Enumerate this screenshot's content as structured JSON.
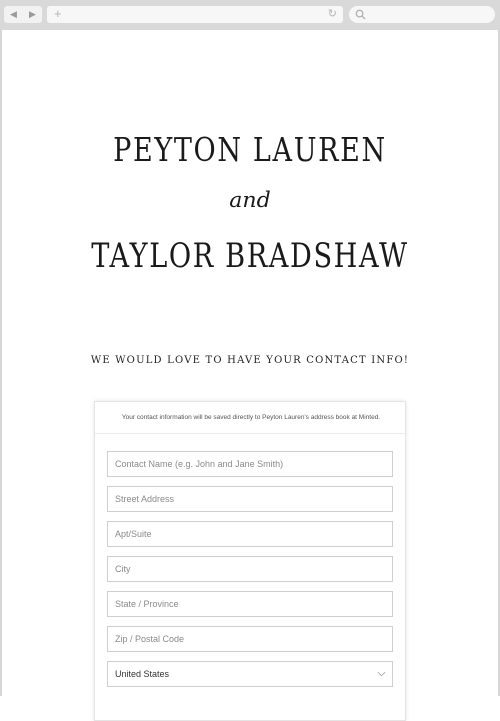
{
  "browser": {
    "back_icon": "◀",
    "forward_icon": "▶",
    "new_tab_icon": "+",
    "reload_icon": "↻"
  },
  "couple": {
    "name1": "PEYTON LAUREN",
    "conjunction": "and",
    "name2": "TAYLOR BRADSHAW"
  },
  "contact": {
    "heading": "WE WOULD LOVE TO HAVE YOUR CONTACT INFO!",
    "note": "Your contact information will be saved directly to Peyton Lauren's address book at Minted.",
    "fields": {
      "name": {
        "placeholder": "Contact Name (e.g. John and Jane Smith)",
        "value": ""
      },
      "street": {
        "placeholder": "Street Address",
        "value": ""
      },
      "apt": {
        "placeholder": "Apt/Suite",
        "value": ""
      },
      "city": {
        "placeholder": "City",
        "value": ""
      },
      "state": {
        "placeholder": "State / Province",
        "value": ""
      },
      "zip": {
        "placeholder": "Zip / Postal Code",
        "value": ""
      }
    },
    "country": {
      "selected": "United States"
    }
  }
}
